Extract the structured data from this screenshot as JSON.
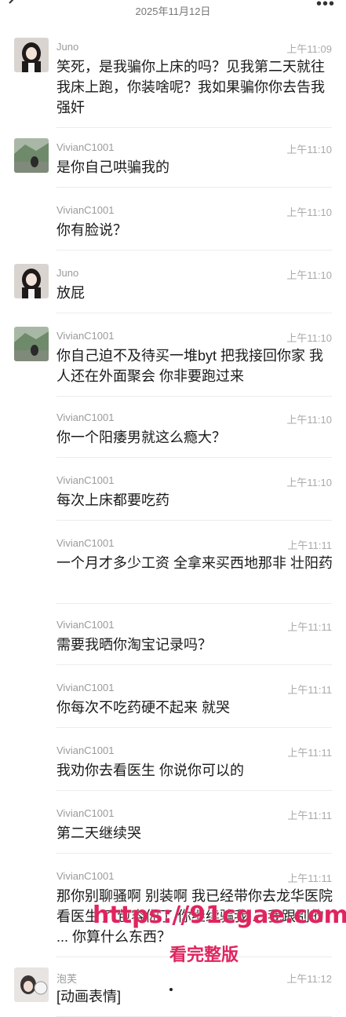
{
  "header": {
    "date": "2025年11月12日"
  },
  "messages": [
    {
      "name": "Juno",
      "time": "上午11:09",
      "text": "笑死，是我骗你上床的吗？见我第二天就往我床上跑，你装啥呢？我如果骗你你去告我强奸",
      "avatar": "juno"
    },
    {
      "name": "VivianC1001",
      "time": "上午11:10",
      "text": "是你自己哄骗我的",
      "avatar": "vivian"
    },
    {
      "name": "VivianC1001",
      "time": "上午11:10",
      "text": "你有脸说？",
      "avatar": ""
    },
    {
      "name": "Juno",
      "time": "上午11:10",
      "text": "放屁",
      "avatar": "juno"
    },
    {
      "name": "VivianC1001",
      "time": "上午11:10",
      "text": "你自己迫不及待买一堆byt 把我接回你家 我人还在外面聚会 你非要跑过来",
      "avatar": "vivian"
    },
    {
      "name": "VivianC1001",
      "time": "上午11:10",
      "text": "你一个阳痿男就这么瘾大？",
      "avatar": ""
    },
    {
      "name": "VivianC1001",
      "time": "上午11:10",
      "text": "每次上床都要吃药",
      "avatar": ""
    },
    {
      "name": "VivianC1001",
      "time": "上午11:11",
      "text": "一个月才多少工资 全拿来买西地那非 壮阳药",
      "avatar": ""
    },
    {
      "name": "VivianC1001",
      "time": "上午11:11",
      "text": "需要我晒你淘宝记录吗？",
      "avatar": ""
    },
    {
      "name": "VivianC1001",
      "time": "上午11:11",
      "text": "你每次不吃药硬不起来 就哭",
      "avatar": ""
    },
    {
      "name": "VivianC1001",
      "time": "上午11:11",
      "text": "我劝你去看医生 你说你可以的",
      "avatar": ""
    },
    {
      "name": "VivianC1001",
      "time": "上午11:11",
      "text": "第二天继续哭",
      "avatar": ""
    },
    {
      "name": "VivianC1001",
      "time": "上午11:11",
      "text": "那你别聊骚啊 别装啊 我已经带你去龙华医院看医生了 包容你了 你继续骗我 ... 我跟别的 ... 你算什么东西？",
      "avatar": ""
    },
    {
      "name": "泡芙",
      "time": "上午11:12",
      "text": "[动画表情]",
      "avatar": "paofu"
    }
  ],
  "watermark": {
    "url": "https://91cgae.com",
    "caption": "看完整版"
  },
  "colors": {
    "watermark": "#e0245e",
    "name": "#9a9a9a",
    "text": "#1a1a1a"
  }
}
